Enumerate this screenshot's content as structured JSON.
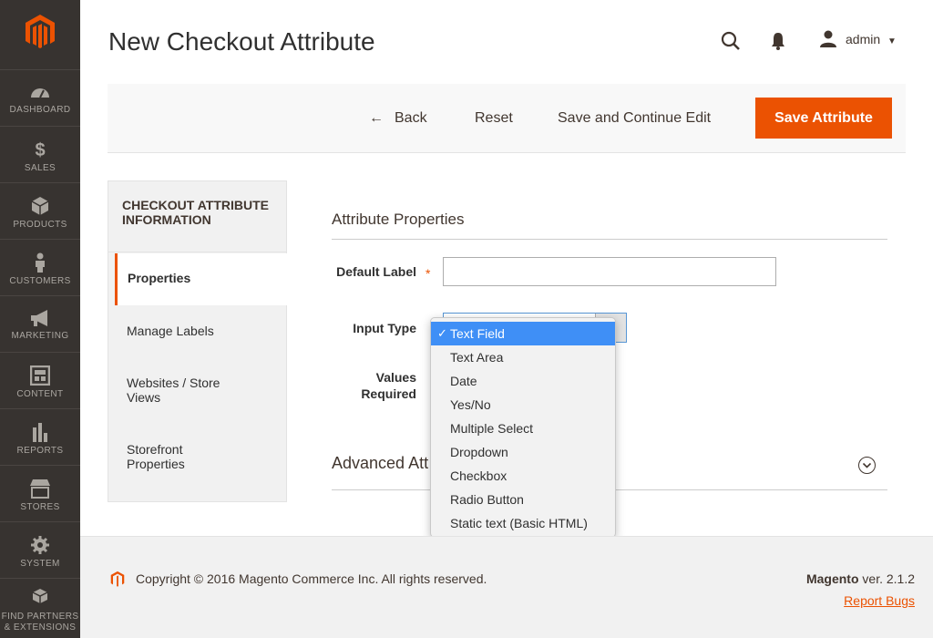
{
  "sidebar": {
    "items": [
      {
        "label": "DASHBOARD",
        "icon": "dashboard-icon"
      },
      {
        "label": "SALES",
        "icon": "dollar-icon"
      },
      {
        "label": "PRODUCTS",
        "icon": "box-icon"
      },
      {
        "label": "CUSTOMERS",
        "icon": "person-icon"
      },
      {
        "label": "MARKETING",
        "icon": "megaphone-icon"
      },
      {
        "label": "CONTENT",
        "icon": "layout-icon"
      },
      {
        "label": "REPORTS",
        "icon": "bar-chart-icon"
      },
      {
        "label": "STORES",
        "icon": "store-icon"
      },
      {
        "label": "SYSTEM",
        "icon": "gear-icon"
      },
      {
        "label": "FIND PARTNERS & EXTENSIONS",
        "label_line1": "FIND PARTNERS",
        "label_line2": "& EXTENSIONS",
        "icon": "cubes-icon"
      }
    ]
  },
  "header": {
    "title": "New Checkout Attribute",
    "user": "admin"
  },
  "actions": {
    "back": "Back",
    "reset": "Reset",
    "save_continue": "Save and Continue Edit",
    "save": "Save Attribute"
  },
  "tabs": {
    "title": "CHECKOUT ATTRIBUTE INFORMATION",
    "items": [
      {
        "label": "Properties"
      },
      {
        "label": "Manage Labels"
      },
      {
        "label": "Websites / Store Views"
      },
      {
        "label": "Storefront Properties"
      }
    ]
  },
  "form": {
    "section_title": "Attribute Properties",
    "default_label": "Default Label",
    "default_label_value": "",
    "required_mark": "*",
    "input_type": "Input Type",
    "values_required": "Values Required",
    "advanced_title": "Advanced Attribute Properties",
    "advanced_title_visible": "Advanced Att"
  },
  "dropdown": {
    "selected": "Text Field",
    "check": "✓",
    "options": [
      "Text Field",
      "Text Area",
      "Date",
      "Yes/No",
      "Multiple Select",
      "Dropdown",
      "Checkbox",
      "Radio Button",
      "Static text (Basic HTML)"
    ]
  },
  "footer": {
    "copyright": "Copyright © 2016 Magento Commerce Inc. All rights reserved.",
    "brand": "Magento",
    "version": " ver. 2.1.2",
    "report": "Report Bugs"
  },
  "colors": {
    "accent": "#eb5202",
    "sidebar": "#373330",
    "selected": "#3f8ff6"
  }
}
